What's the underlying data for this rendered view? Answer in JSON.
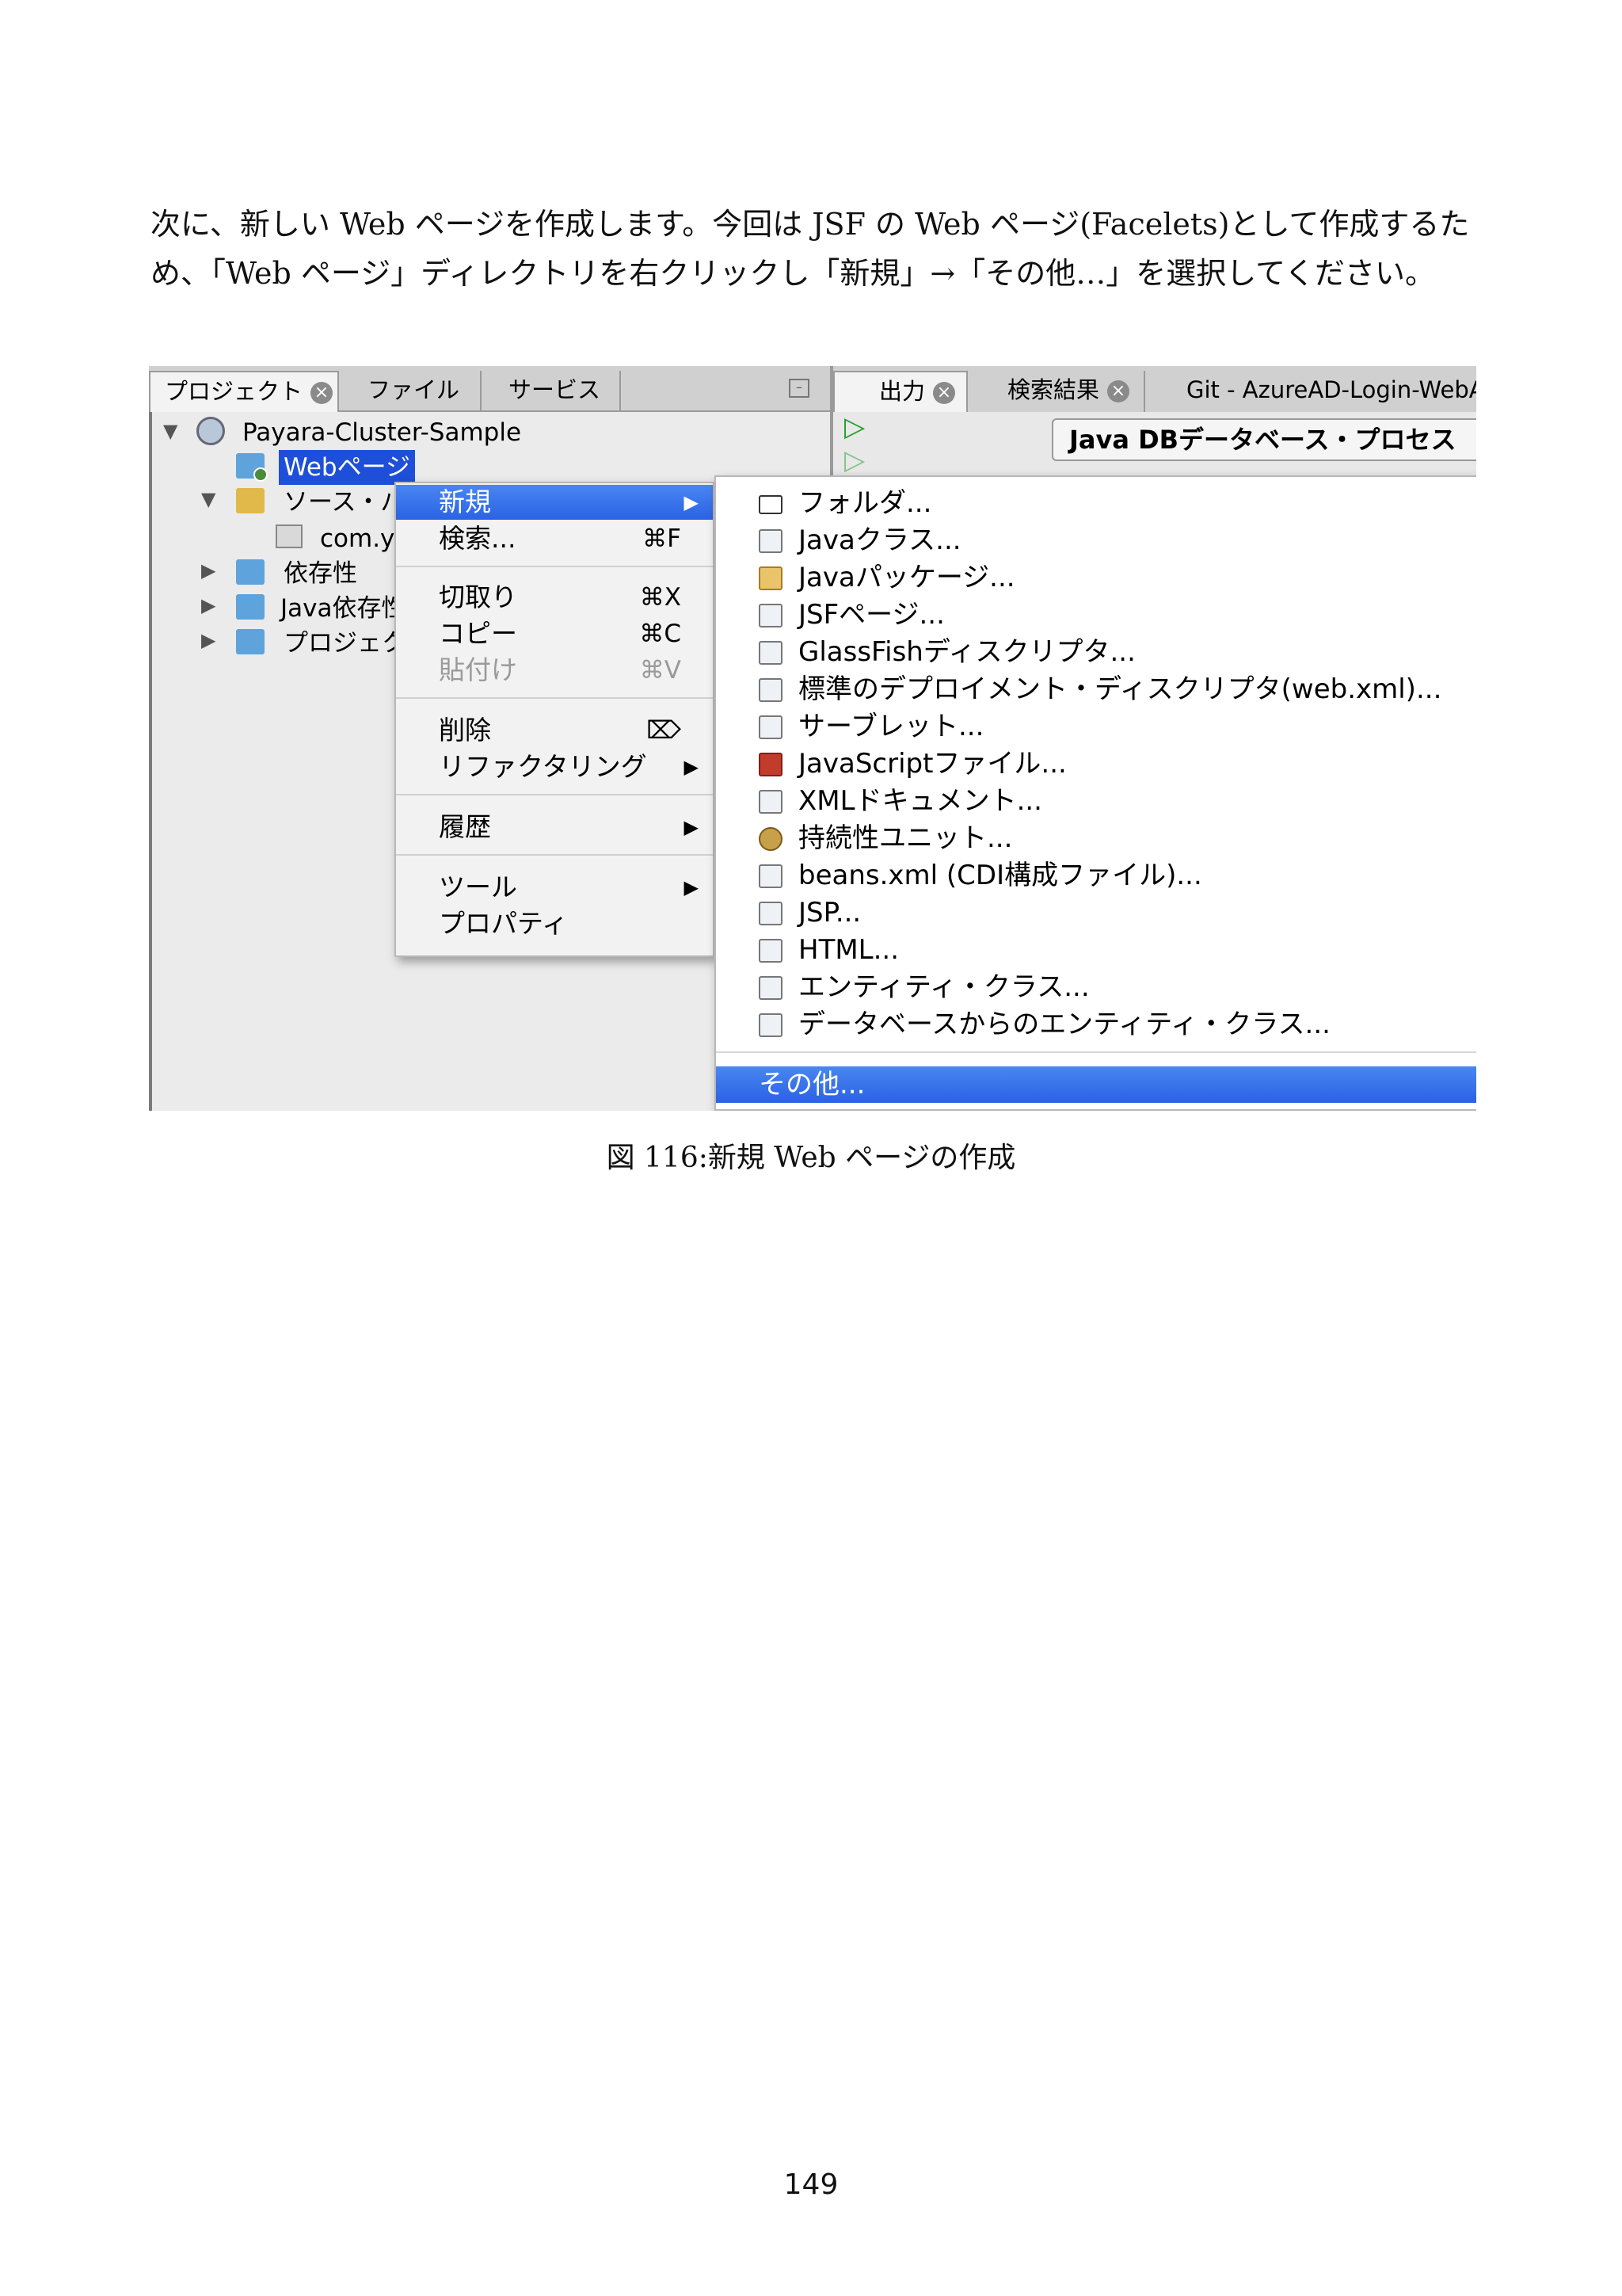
{
  "intro": {
    "line1": "次に、新しい Web ページを作成します。今回は JSF の Web ページ(Facelets)として作成するた",
    "line2": "め、「Web ページ」ディレクトリを右クリックし「新規」→「その他…」を選択してください。"
  },
  "screenshot": {
    "left_tabs": [
      "プロジェクト",
      "ファイル",
      "サービス"
    ],
    "right_tabs": [
      "出力",
      "検索結果",
      "Git - AzureAD-Login-WebA"
    ],
    "jdb_tab": "Java DBデータベース・プロセス",
    "tree": {
      "project": "Payara-Cluster-Sample",
      "web_pages": "Webページ",
      "sources": "ソース・パ",
      "package": "com.yo",
      "deps": "依存性",
      "java_deps": "Java依存性",
      "project_files": "プロジェク"
    },
    "context_menu": [
      {
        "label": "新規",
        "shortcut": "",
        "arrow": true,
        "highlight": true
      },
      {
        "label": "検索...",
        "shortcut": "⌘F"
      },
      {
        "label": "切取り",
        "shortcut": "⌘X"
      },
      {
        "label": "コピー",
        "shortcut": "⌘C"
      },
      {
        "label": "貼付け",
        "shortcut": "⌘V",
        "disabled": true
      },
      {
        "label": "削除",
        "shortcut": "⌦"
      },
      {
        "label": "リファクタリング",
        "arrow": true
      },
      {
        "label": "履歴",
        "arrow": true
      },
      {
        "label": "ツール",
        "arrow": true
      },
      {
        "label": "プロパティ"
      }
    ],
    "submenu": [
      {
        "label": "フォルダ...",
        "icon": "folder-icon"
      },
      {
        "label": "Javaクラス...",
        "icon": "java-class-icon"
      },
      {
        "label": "Javaパッケージ...",
        "icon": "java-package-icon"
      },
      {
        "label": "JSFページ...",
        "icon": "jsf-page-icon"
      },
      {
        "label": "GlassFishディスクリプタ...",
        "icon": "descriptor-icon"
      },
      {
        "label": "標準のデプロイメント・ディスクリプタ(web.xml)...",
        "icon": "descriptor-icon"
      },
      {
        "label": "サーブレット...",
        "icon": "servlet-icon"
      },
      {
        "label": "JavaScriptファイル...",
        "icon": "javascript-icon"
      },
      {
        "label": "XMLドキュメント...",
        "icon": "xml-icon"
      },
      {
        "label": "持続性ユニット...",
        "icon": "persistence-icon"
      },
      {
        "label": "beans.xml (CDI構成ファイル)...",
        "icon": "xml-icon"
      },
      {
        "label": "JSP...",
        "icon": "jsp-icon"
      },
      {
        "label": "HTML...",
        "icon": "html-icon"
      },
      {
        "label": "エンティティ・クラス...",
        "icon": "entity-icon"
      },
      {
        "label": "データベースからのエンティティ・クラス...",
        "icon": "entity-icon"
      },
      {
        "label": "その他...",
        "icon": "",
        "highlight": true
      }
    ]
  },
  "caption": "図 116:新規 Web ページの作成",
  "page_number": "149"
}
